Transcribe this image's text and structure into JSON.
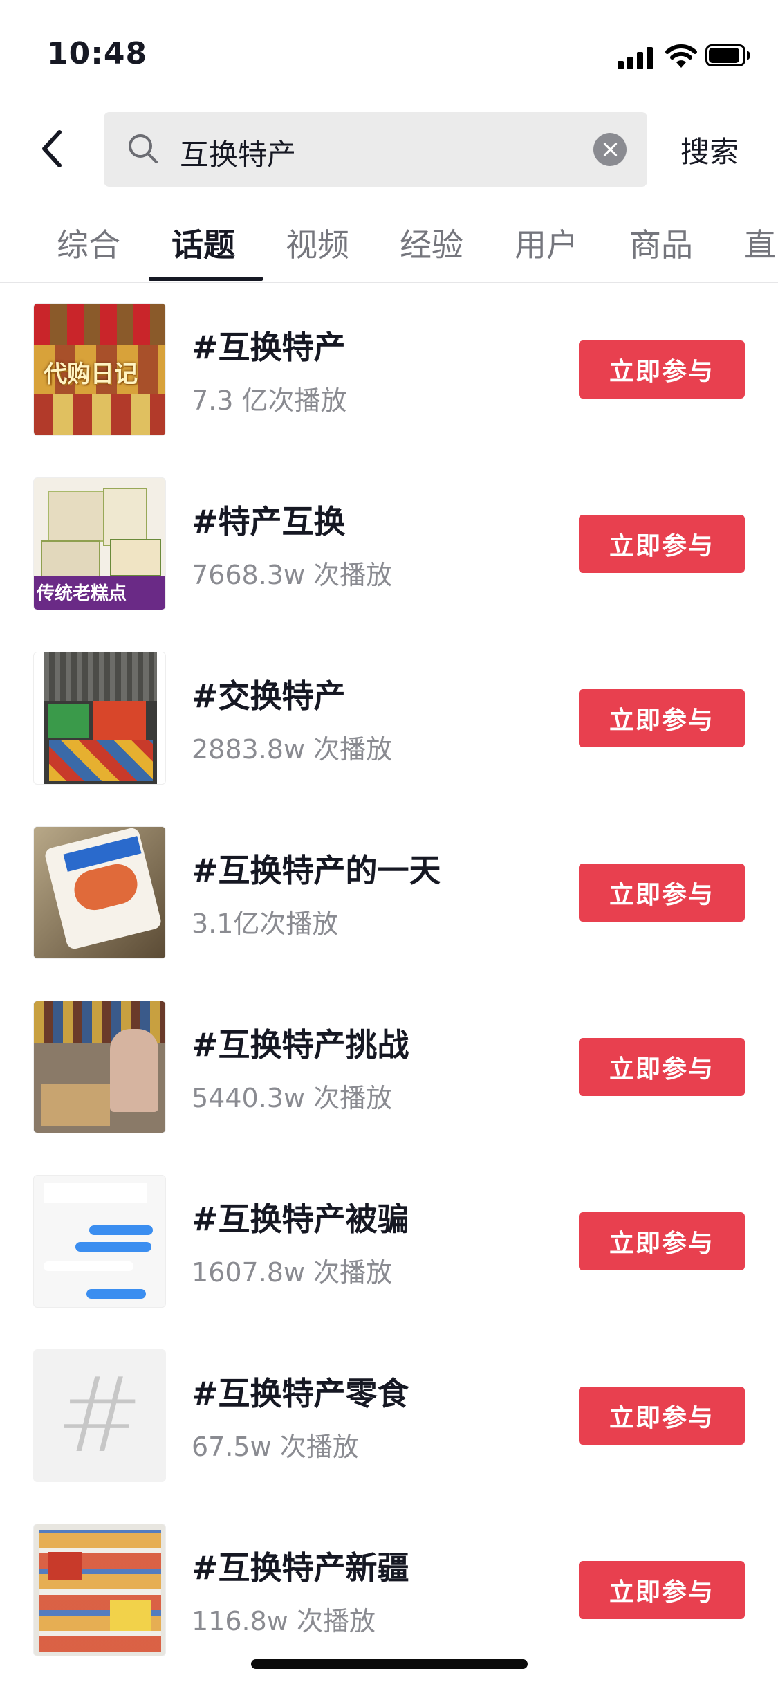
{
  "status_bar": {
    "time": "10:48"
  },
  "search": {
    "query": "互换特产",
    "submit_label": "搜索"
  },
  "tabs": [
    "综合",
    "话题",
    "视频",
    "经验",
    "用户",
    "商品",
    "直"
  ],
  "active_tab": "话题",
  "colors": {
    "accent": "#e8404f",
    "text": "#161823",
    "muted": "#8a8b91"
  },
  "topics": [
    {
      "title": "#互换特产",
      "plays": "7.3 亿次播放",
      "button": "立即参与",
      "thumb_caption": "代购日记"
    },
    {
      "title": "#特产互换",
      "plays": "7668.3w 次播放",
      "button": "立即参与",
      "thumb_caption": "传统老糕点"
    },
    {
      "title": "#交换特产",
      "plays": "2883.8w 次播放",
      "button": "立即参与"
    },
    {
      "title": "#互换特产的一天",
      "plays": "3.1亿次播放",
      "button": "立即参与"
    },
    {
      "title": "#互换特产挑战",
      "plays": "5440.3w 次播放",
      "button": "立即参与"
    },
    {
      "title": "#互换特产被骗",
      "plays": "1607.8w 次播放",
      "button": "立即参与"
    },
    {
      "title": "#互换特产零食",
      "plays": "67.5w 次播放",
      "button": "立即参与",
      "thumb_symbol": "#"
    },
    {
      "title": "#互换特产新疆",
      "plays": "116.8w 次播放",
      "button": "立即参与"
    }
  ]
}
